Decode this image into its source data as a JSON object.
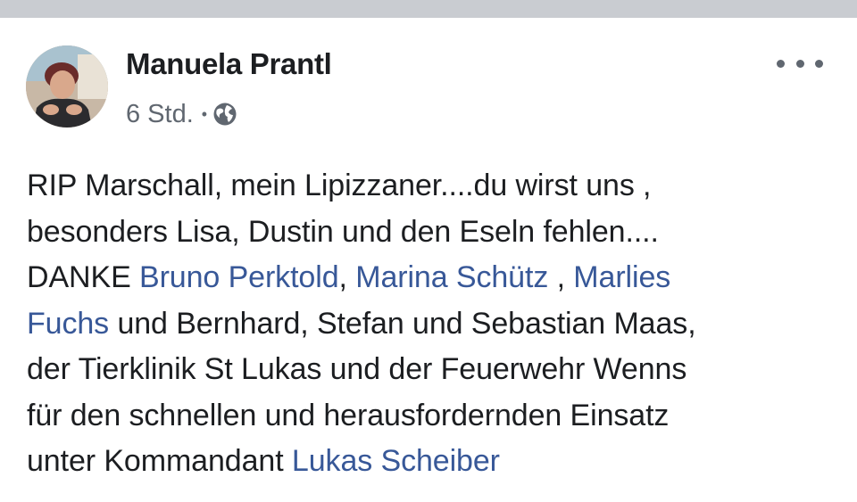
{
  "post": {
    "author": "Manuela Prantl",
    "timestamp": "6 Std.",
    "separator": "•",
    "audience_icon": "globe-icon",
    "more_icon": "more-options-icon",
    "avatar_icon": "profile-photo",
    "text": {
      "line1": "RIP Marschall, mein Lipizzaner....du wirst uns ,",
      "line2": "besonders Lisa, Dustin  und den Eseln fehlen....",
      "line3_prefix": "DANKE ",
      "tag1": "Bruno Perktold",
      "line3_sep1": ", ",
      "tag2": "Marina Schütz",
      "line3_sep2": " , ",
      "tag3_part1": "Marlies",
      "tag3_part2": "Fuchs",
      "line4_rest": " und Bernhard, Stefan und Sebastian Maas,",
      "line5": "der Tierklinik St Lukas und der Feuerwehr Wenns",
      "line6": "für den schnellen und herausfordernden Einsatz",
      "line7_prefix": "unter Kommandant ",
      "tag4": "Lukas Scheiber"
    }
  },
  "colors": {
    "text": "#1c1e21",
    "secondary": "#606770",
    "link": "#385898",
    "divider": "#c9ccd1"
  }
}
